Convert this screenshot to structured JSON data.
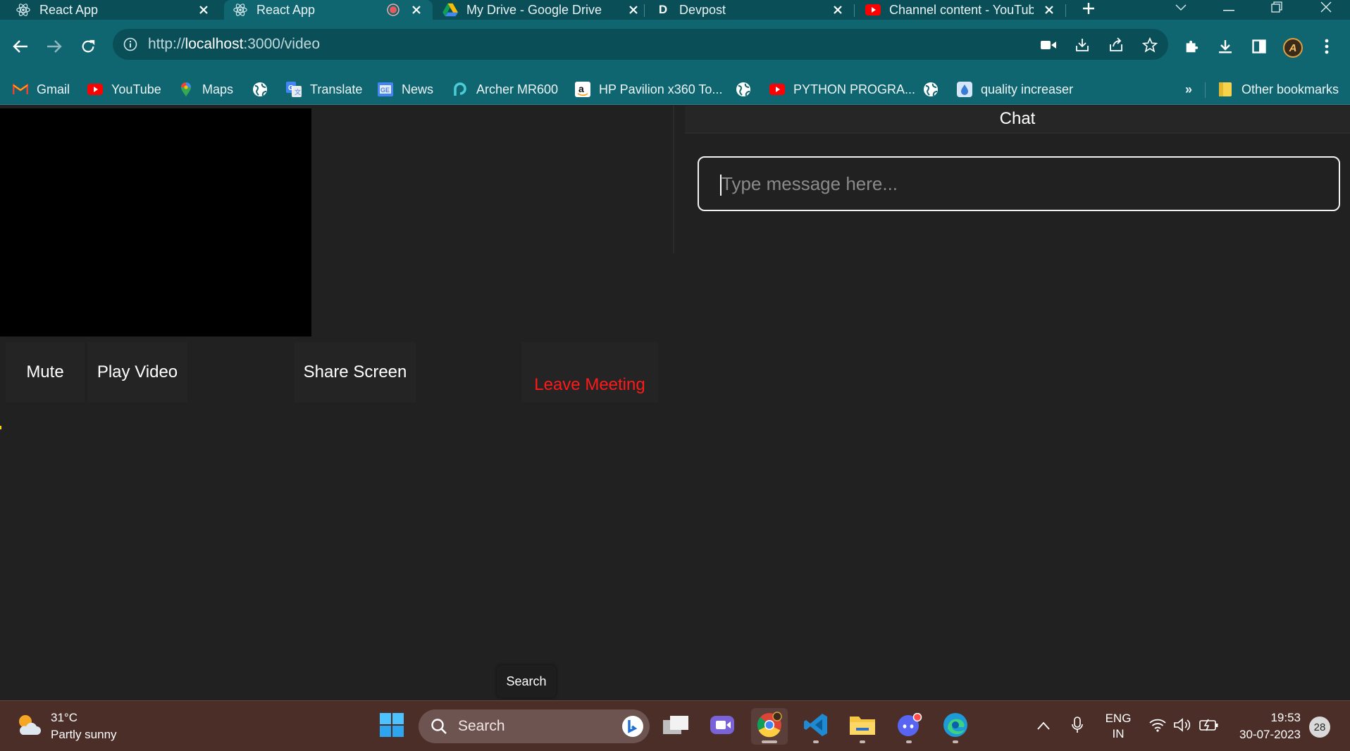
{
  "browser": {
    "tabs": [
      {
        "title": "React App",
        "icon": "react-icon",
        "active": false
      },
      {
        "title": "React App",
        "icon": "react-icon",
        "active": true,
        "recording": true
      },
      {
        "title": "My Drive - Google Drive",
        "icon": "google-drive-icon",
        "active": false
      },
      {
        "title": "Devpost",
        "icon": "devpost-icon",
        "active": false
      },
      {
        "title": "Channel content - YouTube",
        "icon": "youtube-icon",
        "active": false
      }
    ],
    "address_bar": {
      "scheme": "http://",
      "host": "localhost",
      "path": ":3000/video"
    },
    "bookmarks": [
      {
        "label": "Gmail",
        "icon": "gmail-icon"
      },
      {
        "label": "YouTube",
        "icon": "youtube-icon"
      },
      {
        "label": "Maps",
        "icon": "maps-icon"
      },
      {
        "label": "",
        "icon": "globe-icon"
      },
      {
        "label": "Translate",
        "icon": "translate-icon"
      },
      {
        "label": "News",
        "icon": "news-icon"
      },
      {
        "label": "Archer MR600",
        "icon": "tplink-icon"
      },
      {
        "label": "HP Pavilion x360 To...",
        "icon": "amazon-icon"
      },
      {
        "label": "",
        "icon": "globe-icon"
      },
      {
        "label": "PYTHON PROGRA...",
        "icon": "youtube-icon"
      },
      {
        "label": "",
        "icon": "globe-icon"
      },
      {
        "label": "quality increaser",
        "icon": "app-icon"
      }
    ],
    "bookmarks_overflow": "»",
    "other_bookmarks": "Other bookmarks",
    "profile_initial": "A"
  },
  "app": {
    "controls": {
      "mute": "Mute",
      "play_video": "Play Video",
      "share_screen": "Share Screen",
      "leave_meeting": "Leave Meeting"
    },
    "chat": {
      "title": "Chat",
      "input_placeholder": "Type message here..."
    }
  },
  "tooltip": "Search",
  "taskbar": {
    "weather": {
      "temp": "31°C",
      "condition": "Partly sunny"
    },
    "search_placeholder": "Search",
    "language": {
      "line1": "ENG",
      "line2": "IN"
    },
    "clock": {
      "time": "19:53",
      "date": "30-07-2023"
    },
    "notification_count": "28"
  },
  "colors": {
    "tab_strip": "#0a4f58",
    "toolbar": "#0f6670",
    "page_background": "#212121",
    "leave_text": "#ff1a1a",
    "taskbar": "#4c2e29"
  }
}
